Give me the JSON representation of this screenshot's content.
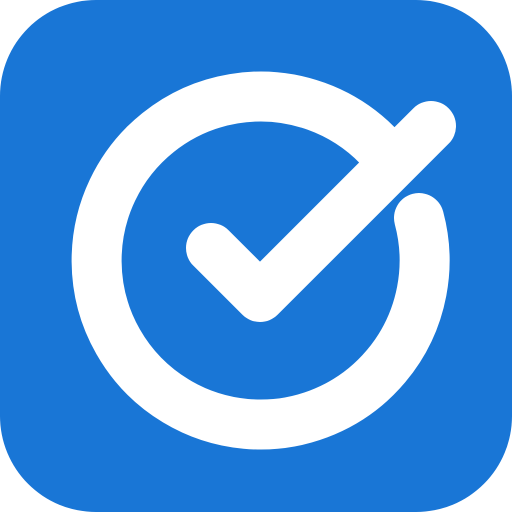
{
  "icon": {
    "name": "check-circle-icon",
    "background_color": "#1976d6",
    "foreground_color": "#ffffff"
  }
}
